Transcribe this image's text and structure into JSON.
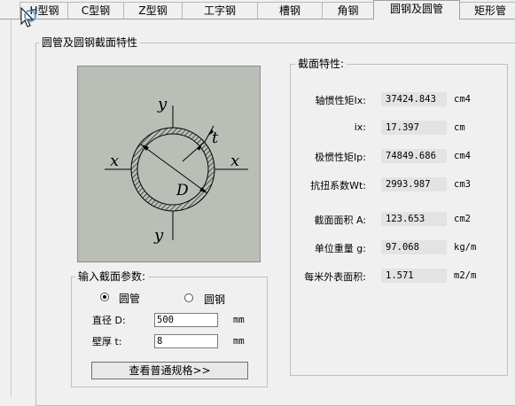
{
  "tabs": [
    {
      "label": "H型钢"
    },
    {
      "label": "C型钢"
    },
    {
      "label": "Z型钢"
    },
    {
      "label": "工字钢"
    },
    {
      "label": "槽钢"
    },
    {
      "label": "角钢"
    },
    {
      "label": "圆钢及圆管"
    },
    {
      "label": "矩形管"
    }
  ],
  "active_tab": "圆钢及圆管",
  "main_group_title": "圆管及圆钢截面特性",
  "figure": {
    "y_top": "y",
    "y_bottom": "y",
    "x_left": "x",
    "x_right": "x",
    "t_label": "t",
    "d_label": "D",
    "background_color": "#b9bfb6"
  },
  "input_group": {
    "title": "输入截面参数:",
    "radio_pipe_label": "圆管",
    "radio_pipe_selected": true,
    "radio_bar_label": "圆钢",
    "radio_bar_selected": false,
    "diameter_label": "直径 D:",
    "diameter_value": "500",
    "diameter_unit": "mm",
    "thickness_label": "壁厚 t:",
    "thickness_value": "8",
    "thickness_unit": "mm",
    "button_label": "查看普通规格>>"
  },
  "props_group": {
    "title": "截面特性:",
    "rows": [
      {
        "label": "轴惯性矩Ix:",
        "value": "37424.843",
        "unit": "cm4"
      },
      {
        "label": "ix:",
        "value": "17.397",
        "unit": "cm"
      },
      {
        "label": "极惯性矩Ip:",
        "value": "74849.686",
        "unit": "cm4"
      },
      {
        "label": "抗扭系数Wt:",
        "value": "2993.987",
        "unit": "cm3"
      },
      {
        "label": "截面面积 A:",
        "value": "123.653",
        "unit": "cm2"
      },
      {
        "label": "单位重量 g:",
        "value": "97.068",
        "unit": "kg/m"
      },
      {
        "label": "每米外表面积:",
        "value": "1.571",
        "unit": "m2/m"
      }
    ]
  }
}
